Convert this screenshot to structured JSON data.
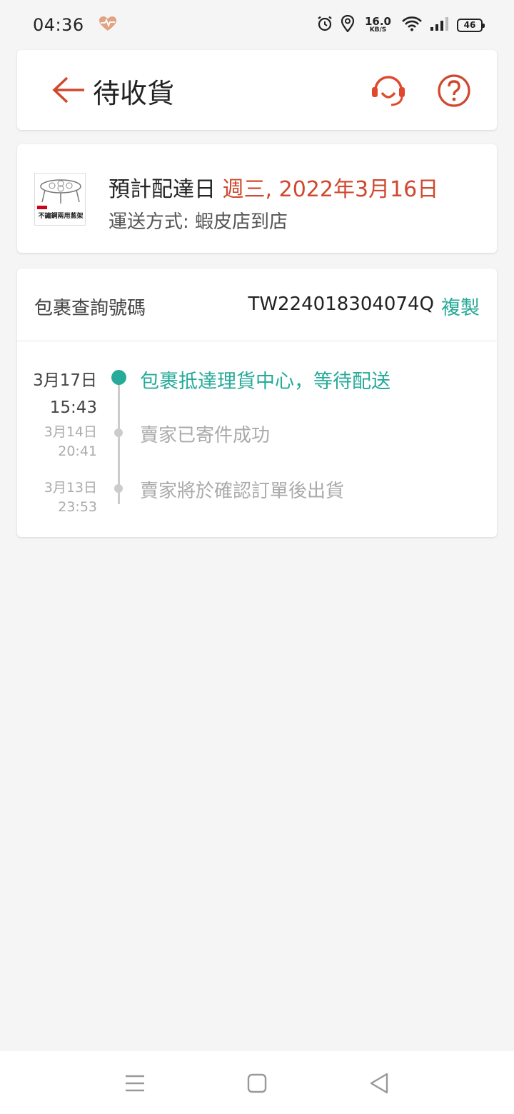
{
  "status_bar": {
    "time": "04:36",
    "speed_value": "16.0",
    "speed_unit": "KB/S",
    "battery": "46"
  },
  "header": {
    "title": "待收貨"
  },
  "delivery": {
    "thumb_label": "不鏽鋼兩用蒸架",
    "eta_label": "預計配達日 ",
    "eta_date": "週三, 2022年3月16日",
    "shipping_method": "運送方式: 蝦皮店到店"
  },
  "tracking": {
    "label": "包裹查詢號碼",
    "number": "TW224018304074Q",
    "copy_label": "複製",
    "events": [
      {
        "date": "3月17日",
        "time": "15:43",
        "text": "包裹抵達理貨中心，等待配送"
      },
      {
        "date": "3月14日",
        "time": "20:41",
        "text": "賣家已寄件成功"
      },
      {
        "date": "3月13日",
        "time": "23:53",
        "text": "賣家將於確認訂單後出貨"
      }
    ]
  },
  "colors": {
    "accent": "#d0482e",
    "teal": "#26aa99",
    "muted": "#aaaaaa"
  }
}
